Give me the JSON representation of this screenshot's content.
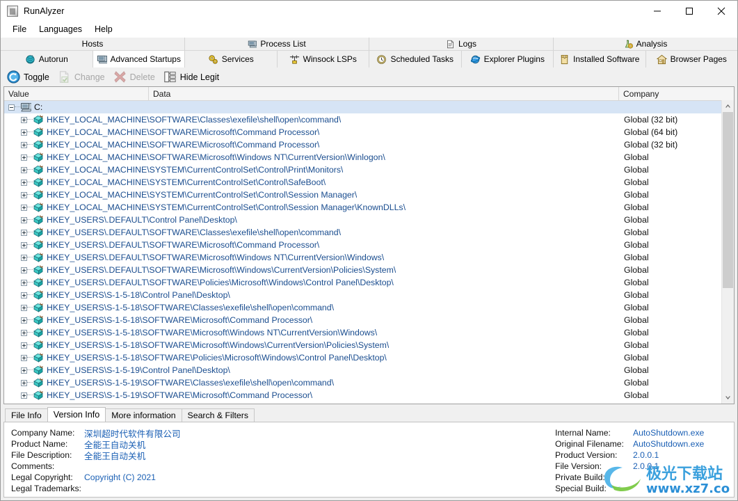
{
  "window": {
    "title": "RunAlyzer",
    "icon": "app-icon",
    "buttons": {
      "minimize": "—",
      "maximize": "□",
      "close": "✕"
    }
  },
  "menubar": {
    "items": [
      "File",
      "Languages",
      "Help"
    ]
  },
  "tabs_top": [
    {
      "label": "Hosts",
      "icon": ""
    },
    {
      "label": "Process List",
      "icon": "monitor-icon"
    },
    {
      "label": "Logs",
      "icon": "document-icon"
    },
    {
      "label": "Analysis",
      "icon": "analysis-icon"
    }
  ],
  "tabs_second": [
    {
      "label": "Autorun",
      "icon": "autorun-icon",
      "active": false
    },
    {
      "label": "Advanced Startups",
      "icon": "monitor-icon",
      "active": true
    },
    {
      "label": "Services",
      "icon": "gears-icon",
      "active": false
    },
    {
      "label": "Winsock LSPs",
      "icon": "winsock-icon",
      "active": false
    },
    {
      "label": "Scheduled Tasks",
      "icon": "clock-icon",
      "active": false
    },
    {
      "label": "Explorer Plugins",
      "icon": "internet-explorer-icon",
      "active": false
    },
    {
      "label": "Installed Software",
      "icon": "package-icon",
      "active": false
    },
    {
      "label": "Browser Pages",
      "icon": "home-icon",
      "active": false
    }
  ],
  "toolbar": [
    {
      "label": "Toggle",
      "icon": "toggle-icon",
      "disabled": false
    },
    {
      "label": "Change",
      "icon": "change-icon",
      "disabled": true
    },
    {
      "label": "Delete",
      "icon": "delete-icon",
      "disabled": true
    },
    {
      "label": "Hide Legit",
      "icon": "hide-legit-icon",
      "disabled": false
    }
  ],
  "list": {
    "columns": [
      "Value",
      "Data",
      "Company"
    ],
    "rows": [
      {
        "level": 0,
        "expander": "minus",
        "icon": "computer-icon",
        "value": "C:",
        "data": "",
        "company": "",
        "selected": true,
        "style": "root"
      },
      {
        "level": 1,
        "expander": "plus",
        "icon": "registry-icon",
        "value": "HKEY_LOCAL_MACHINE\\SOFTWARE\\Classes\\exefile\\shell\\open\\command\\",
        "data": "",
        "company": "Global (32 bit)",
        "selected": false,
        "style": "reg"
      },
      {
        "level": 1,
        "expander": "plus",
        "icon": "registry-icon",
        "value": "HKEY_LOCAL_MACHINE\\SOFTWARE\\Microsoft\\Command Processor\\",
        "data": "",
        "company": "Global (64 bit)",
        "selected": false,
        "style": "reg"
      },
      {
        "level": 1,
        "expander": "plus",
        "icon": "registry-icon",
        "value": "HKEY_LOCAL_MACHINE\\SOFTWARE\\Microsoft\\Command Processor\\",
        "data": "",
        "company": "Global (32 bit)",
        "selected": false,
        "style": "reg"
      },
      {
        "level": 1,
        "expander": "plus",
        "icon": "registry-icon",
        "value": "HKEY_LOCAL_MACHINE\\SOFTWARE\\Microsoft\\Windows NT\\CurrentVersion\\Winlogon\\",
        "data": "",
        "company": "Global",
        "selected": false,
        "style": "reg"
      },
      {
        "level": 1,
        "expander": "plus",
        "icon": "registry-icon",
        "value": "HKEY_LOCAL_MACHINE\\SYSTEM\\CurrentControlSet\\Control\\Print\\Monitors\\",
        "data": "",
        "company": "Global",
        "selected": false,
        "style": "reg"
      },
      {
        "level": 1,
        "expander": "plus",
        "icon": "registry-icon",
        "value": "HKEY_LOCAL_MACHINE\\SYSTEM\\CurrentControlSet\\Control\\SafeBoot\\",
        "data": "",
        "company": "Global",
        "selected": false,
        "style": "reg"
      },
      {
        "level": 1,
        "expander": "plus",
        "icon": "registry-icon",
        "value": "HKEY_LOCAL_MACHINE\\SYSTEM\\CurrentControlSet\\Control\\Session Manager\\",
        "data": "",
        "company": "Global",
        "selected": false,
        "style": "reg"
      },
      {
        "level": 1,
        "expander": "plus",
        "icon": "registry-icon",
        "value": "HKEY_LOCAL_MACHINE\\SYSTEM\\CurrentControlSet\\Control\\Session Manager\\KnownDLLs\\",
        "data": "",
        "company": "Global",
        "selected": false,
        "style": "reg"
      },
      {
        "level": 1,
        "expander": "plus",
        "icon": "registry-icon",
        "value": "HKEY_USERS\\.DEFAULT\\Control Panel\\Desktop\\",
        "data": "",
        "company": "Global",
        "selected": false,
        "style": "reg"
      },
      {
        "level": 1,
        "expander": "plus",
        "icon": "registry-icon",
        "value": "HKEY_USERS\\.DEFAULT\\SOFTWARE\\Classes\\exefile\\shell\\open\\command\\",
        "data": "",
        "company": "Global",
        "selected": false,
        "style": "reg"
      },
      {
        "level": 1,
        "expander": "plus",
        "icon": "registry-icon",
        "value": "HKEY_USERS\\.DEFAULT\\SOFTWARE\\Microsoft\\Command Processor\\",
        "data": "",
        "company": "Global",
        "selected": false,
        "style": "reg"
      },
      {
        "level": 1,
        "expander": "plus",
        "icon": "registry-icon",
        "value": "HKEY_USERS\\.DEFAULT\\SOFTWARE\\Microsoft\\Windows NT\\CurrentVersion\\Windows\\",
        "data": "",
        "company": "Global",
        "selected": false,
        "style": "reg"
      },
      {
        "level": 1,
        "expander": "plus",
        "icon": "registry-icon",
        "value": "HKEY_USERS\\.DEFAULT\\SOFTWARE\\Microsoft\\Windows\\CurrentVersion\\Policies\\System\\",
        "data": "",
        "company": "Global",
        "selected": false,
        "style": "reg"
      },
      {
        "level": 1,
        "expander": "plus",
        "icon": "registry-icon",
        "value": "HKEY_USERS\\.DEFAULT\\SOFTWARE\\Policies\\Microsoft\\Windows\\Control Panel\\Desktop\\",
        "data": "",
        "company": "Global",
        "selected": false,
        "style": "reg"
      },
      {
        "level": 1,
        "expander": "plus",
        "icon": "registry-icon",
        "value": "HKEY_USERS\\S-1-5-18\\Control Panel\\Desktop\\",
        "data": "",
        "company": "Global",
        "selected": false,
        "style": "reg"
      },
      {
        "level": 1,
        "expander": "plus",
        "icon": "registry-icon",
        "value": "HKEY_USERS\\S-1-5-18\\SOFTWARE\\Classes\\exefile\\shell\\open\\command\\",
        "data": "",
        "company": "Global",
        "selected": false,
        "style": "reg"
      },
      {
        "level": 1,
        "expander": "plus",
        "icon": "registry-icon",
        "value": "HKEY_USERS\\S-1-5-18\\SOFTWARE\\Microsoft\\Command Processor\\",
        "data": "",
        "company": "Global",
        "selected": false,
        "style": "reg"
      },
      {
        "level": 1,
        "expander": "plus",
        "icon": "registry-icon",
        "value": "HKEY_USERS\\S-1-5-18\\SOFTWARE\\Microsoft\\Windows NT\\CurrentVersion\\Windows\\",
        "data": "",
        "company": "Global",
        "selected": false,
        "style": "reg"
      },
      {
        "level": 1,
        "expander": "plus",
        "icon": "registry-icon",
        "value": "HKEY_USERS\\S-1-5-18\\SOFTWARE\\Microsoft\\Windows\\CurrentVersion\\Policies\\System\\",
        "data": "",
        "company": "Global",
        "selected": false,
        "style": "reg"
      },
      {
        "level": 1,
        "expander": "plus",
        "icon": "registry-icon",
        "value": "HKEY_USERS\\S-1-5-18\\SOFTWARE\\Policies\\Microsoft\\Windows\\Control Panel\\Desktop\\",
        "data": "",
        "company": "Global",
        "selected": false,
        "style": "reg"
      },
      {
        "level": 1,
        "expander": "plus",
        "icon": "registry-icon",
        "value": "HKEY_USERS\\S-1-5-19\\Control Panel\\Desktop\\",
        "data": "",
        "company": "Global",
        "selected": false,
        "style": "reg"
      },
      {
        "level": 1,
        "expander": "plus",
        "icon": "registry-icon",
        "value": "HKEY_USERS\\S-1-5-19\\SOFTWARE\\Classes\\exefile\\shell\\open\\command\\",
        "data": "",
        "company": "Global",
        "selected": false,
        "style": "reg"
      },
      {
        "level": 1,
        "expander": "plus",
        "icon": "registry-icon",
        "value": "HKEY_USERS\\S-1-5-19\\SOFTWARE\\Microsoft\\Command Processor\\",
        "data": "",
        "company": "Global",
        "selected": false,
        "style": "reg"
      }
    ],
    "scrollbar": {
      "thumb_percent": 63
    }
  },
  "bottom_tabs": [
    {
      "label": "File Info",
      "active": false
    },
    {
      "label": "Version Info",
      "active": true
    },
    {
      "label": "More information",
      "active": false
    },
    {
      "label": "Search & Filters",
      "active": false
    }
  ],
  "version_info": {
    "left": [
      {
        "key": "Company Name:",
        "value": "深圳超时代软件有限公司",
        "cjk": true
      },
      {
        "key": "Product Name:",
        "value": "全能王自动关机",
        "cjk": true
      },
      {
        "key": "File Description:",
        "value": "全能王自动关机",
        "cjk": true
      },
      {
        "key": "Comments:",
        "value": "",
        "cjk": false
      },
      {
        "key": "Legal Copyright:",
        "value": "Copyright (C) 2021",
        "cjk": false
      },
      {
        "key": "Legal Trademarks:",
        "value": "",
        "cjk": false
      }
    ],
    "right": [
      {
        "key": "Internal Name:",
        "value": "AutoShutdown.exe",
        "cjk": false
      },
      {
        "key": "Original Filename:",
        "value": "AutoShutdown.exe",
        "cjk": false
      },
      {
        "key": "Product Version:",
        "value": "2.0.0.1",
        "cjk": false
      },
      {
        "key": "File Version:",
        "value": "2.0.0.1",
        "cjk": false
      },
      {
        "key": "Private Build:",
        "value": "",
        "cjk": false
      },
      {
        "key": "Special Build:",
        "value": "",
        "cjk": false
      }
    ]
  },
  "watermark": {
    "text_cn": "极光下载站",
    "text_url": "www.xz7.com",
    "color_cn": "#3aa0dd",
    "color_url": "#2b8fd6"
  },
  "colors": {
    "registry_text": "#1a4d8f",
    "value_text": "#1a5fb4",
    "selection": "#d6e4f5",
    "window_bg": "#f0f0f0"
  }
}
